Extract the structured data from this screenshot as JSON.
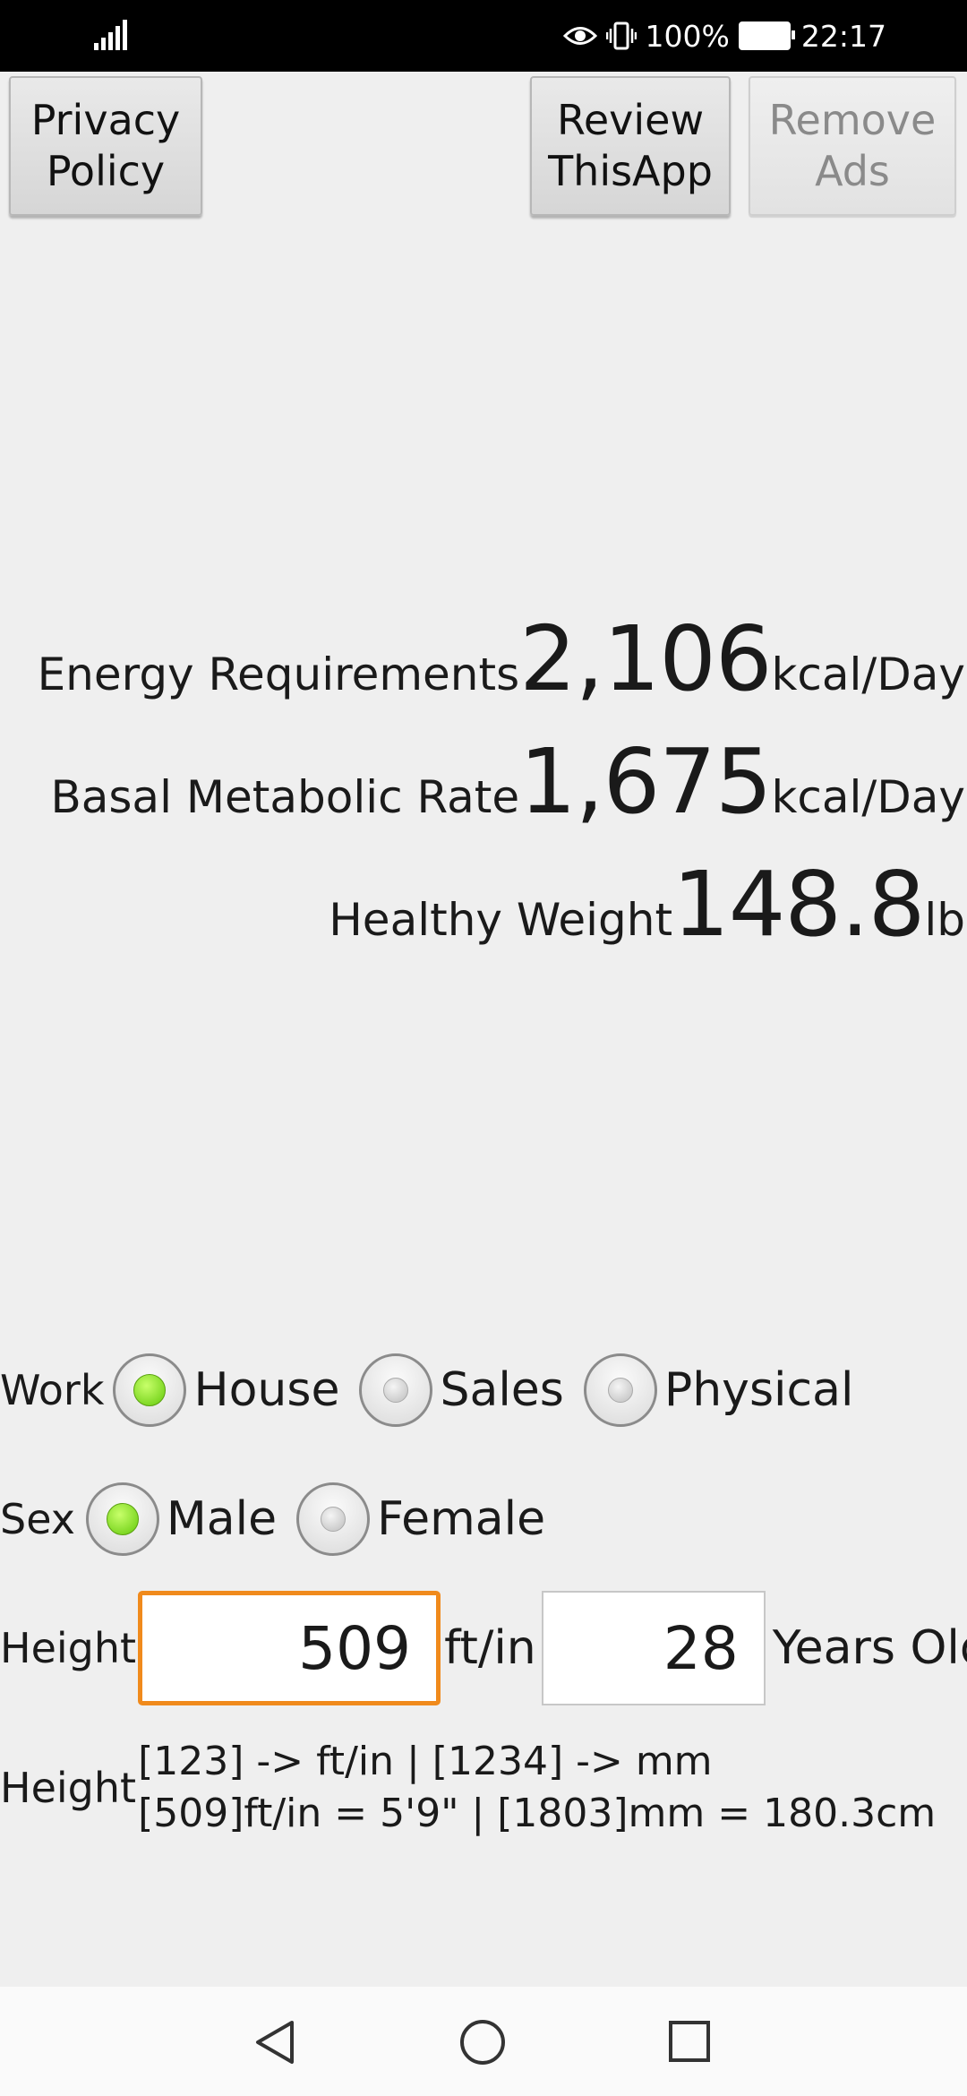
{
  "status_bar": {
    "battery": "100%",
    "time": "22:17"
  },
  "top_buttons": {
    "privacy": [
      "Privacy",
      "Policy"
    ],
    "review": [
      "Review",
      "ThisApp"
    ],
    "remove_ads": [
      "Remove",
      "Ads"
    ]
  },
  "results": {
    "energy": {
      "label": "Energy Requirements",
      "value": "2,106",
      "unit": "kcal/Day"
    },
    "bmr": {
      "label": "Basal Metabolic Rate",
      "value": "1,675",
      "unit": "kcal/Day"
    },
    "weight": {
      "label": "Healthy Weight",
      "value": "148.8",
      "unit": "lb"
    }
  },
  "work": {
    "label": "Work",
    "options": [
      "House",
      "Sales",
      "Physical"
    ],
    "selected": "House"
  },
  "sex": {
    "label": "Sex",
    "options": [
      "Male",
      "Female"
    ],
    "selected": "Male"
  },
  "height_input": {
    "label": "Height",
    "value": "509",
    "unit": "ft/in",
    "age_value": "28",
    "age_unit": "Years Old"
  },
  "height_hint": {
    "label": "Height",
    "line1": "[123] -> ft/in | [1234] -> mm",
    "line2": "[509]ft/in = 5'9\" | [1803]mm = 180.3cm"
  }
}
